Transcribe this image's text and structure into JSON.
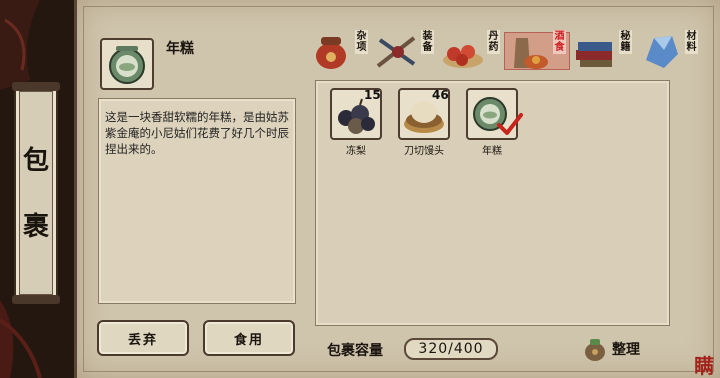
{
  "side_tab": {
    "chars": [
      "包",
      "裹"
    ]
  },
  "selected_item": {
    "name": "年糕",
    "description": "这是一块香甜软糯的年糕，是由姑苏紫金庵的小尼姑们花费了好几个时辰捏出来的。"
  },
  "category_tabs": [
    {
      "label": "杂项",
      "icon": "pot-icon",
      "active": false
    },
    {
      "label": "装备",
      "icon": "weapons-icon",
      "active": false
    },
    {
      "label": "丹药",
      "icon": "pills-icon",
      "active": false
    },
    {
      "label": "酒食",
      "icon": "wine-food-icon",
      "active": true
    },
    {
      "label": "秘籍",
      "icon": "books-icon",
      "active": false
    },
    {
      "label": "材料",
      "icon": "crystal-icon",
      "active": false
    }
  ],
  "items": [
    {
      "label": "冻梨",
      "count": "15",
      "icon": "frozen-pear-icon",
      "selected": false
    },
    {
      "label": "刀切馒头",
      "count": "46",
      "icon": "steamed-bun-icon",
      "selected": false
    },
    {
      "label": "年糕",
      "count": "",
      "icon": "rice-cake-icon",
      "selected": true
    }
  ],
  "actions": {
    "discard": "丢弃",
    "eat": "食用"
  },
  "capacity": {
    "label": "包裹容量",
    "value": "320/400"
  },
  "sort": {
    "label": "整理",
    "icon": "bag-icon"
  },
  "seal": {
    "text": "瞒"
  },
  "colors": {
    "parchment": "#cfc4ac",
    "border": "#4d3d2e",
    "active_tab": "#c22222",
    "check": "#c8241c"
  }
}
